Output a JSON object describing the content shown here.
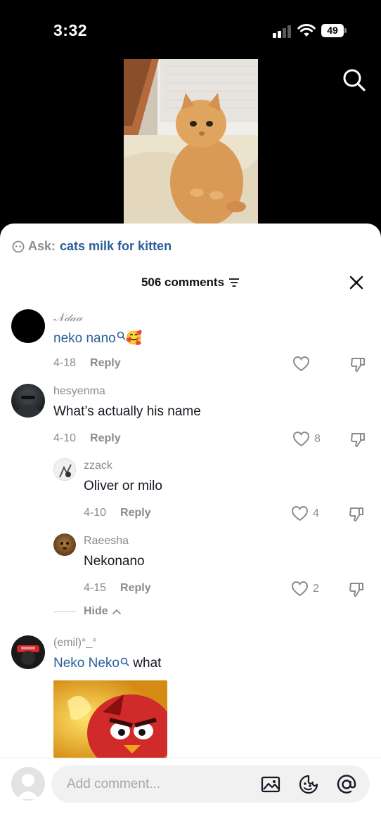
{
  "status": {
    "time": "3:32",
    "battery": "49"
  },
  "ask": {
    "label": "Ask:",
    "query": "cats milk for kitten"
  },
  "header": {
    "comments_count": "506 comments"
  },
  "comments": [
    {
      "username": "𝒩𝒹𝒶𝒶",
      "mention": "neko nano",
      "text_suffix": "🥰",
      "date": "4-18",
      "reply": "Reply",
      "likes": ""
    },
    {
      "username": "hesyenma",
      "text": "What’s actually his name",
      "date": "4-10",
      "reply": "Reply",
      "likes": "8"
    },
    {
      "username": "zzack",
      "text": "Oliver or milo",
      "date": "4-10",
      "reply": "Reply",
      "likes": "4"
    },
    {
      "username": "Raeesha",
      "text": "Nekonano",
      "date": "4-15",
      "reply": "Reply",
      "likes": "2"
    },
    {
      "username": "(emil)°_°",
      "mention": "Neko Neko",
      "text_suffix": " what"
    }
  ],
  "hide_label": "Hide",
  "input": {
    "placeholder": "Add comment..."
  },
  "colors": {
    "link": "#2a5f99",
    "muted": "#8a8b91",
    "text": "#161823"
  },
  "icons": [
    "search-icon",
    "close-icon",
    "filter-icon",
    "heart-icon",
    "dislike-icon",
    "image-icon",
    "emoji-icon",
    "at-icon"
  ]
}
